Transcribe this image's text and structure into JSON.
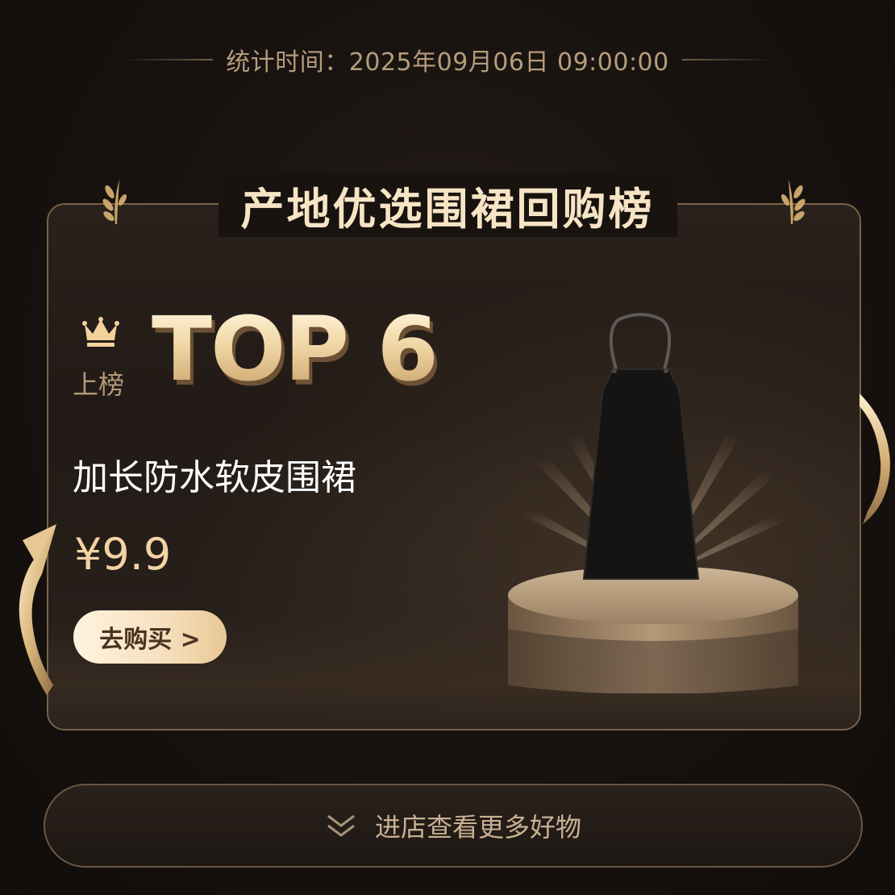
{
  "header": {
    "stat_time": "统计时间：2025年09月06日 09:00:00"
  },
  "title": "产地优选围裙回购榜",
  "rank": {
    "badge_label": "上榜",
    "top_text": "TOP 6"
  },
  "product": {
    "name": "加长防水软皮围裙",
    "price": "¥9.9",
    "buy_label": "去购买 >"
  },
  "footer": {
    "more_label": "进店查看更多好物"
  },
  "colors": {
    "background": "#17120f",
    "gold": "#f2d3a2",
    "card_border": "#7a6248"
  },
  "icons": [
    "crown-icon",
    "wheat-icon",
    "chevron-double-down-icon"
  ]
}
